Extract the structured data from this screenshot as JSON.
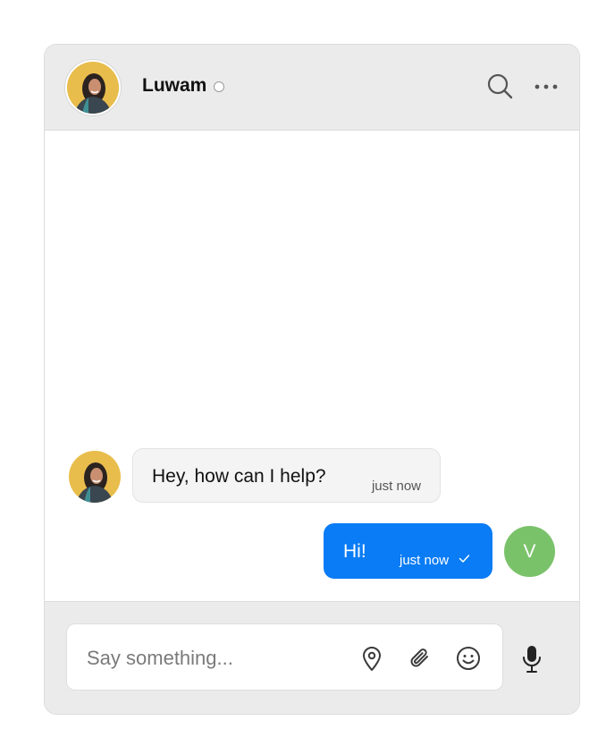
{
  "header": {
    "contact_name": "Luwam",
    "status": "offline",
    "icons": [
      "search-icon",
      "more-options-icon"
    ]
  },
  "messages": [
    {
      "direction": "incoming",
      "text": "Hey, how can I help?",
      "time": "just now"
    },
    {
      "direction": "outgoing",
      "text": "Hi!",
      "time": "just now",
      "status": "sent"
    }
  ],
  "user": {
    "initial": "V"
  },
  "composer": {
    "placeholder": "Say something...",
    "value": "",
    "icons": [
      "location-icon",
      "attachment-icon",
      "emoji-icon",
      "microphone-icon"
    ]
  },
  "colors": {
    "accent": "#0a7cf5",
    "user_avatar": "#7ac26a",
    "header_bg": "#ebebeb",
    "incoming_bubble": "#f4f4f4",
    "contact_avatar_bg": "#e9bd4c"
  }
}
